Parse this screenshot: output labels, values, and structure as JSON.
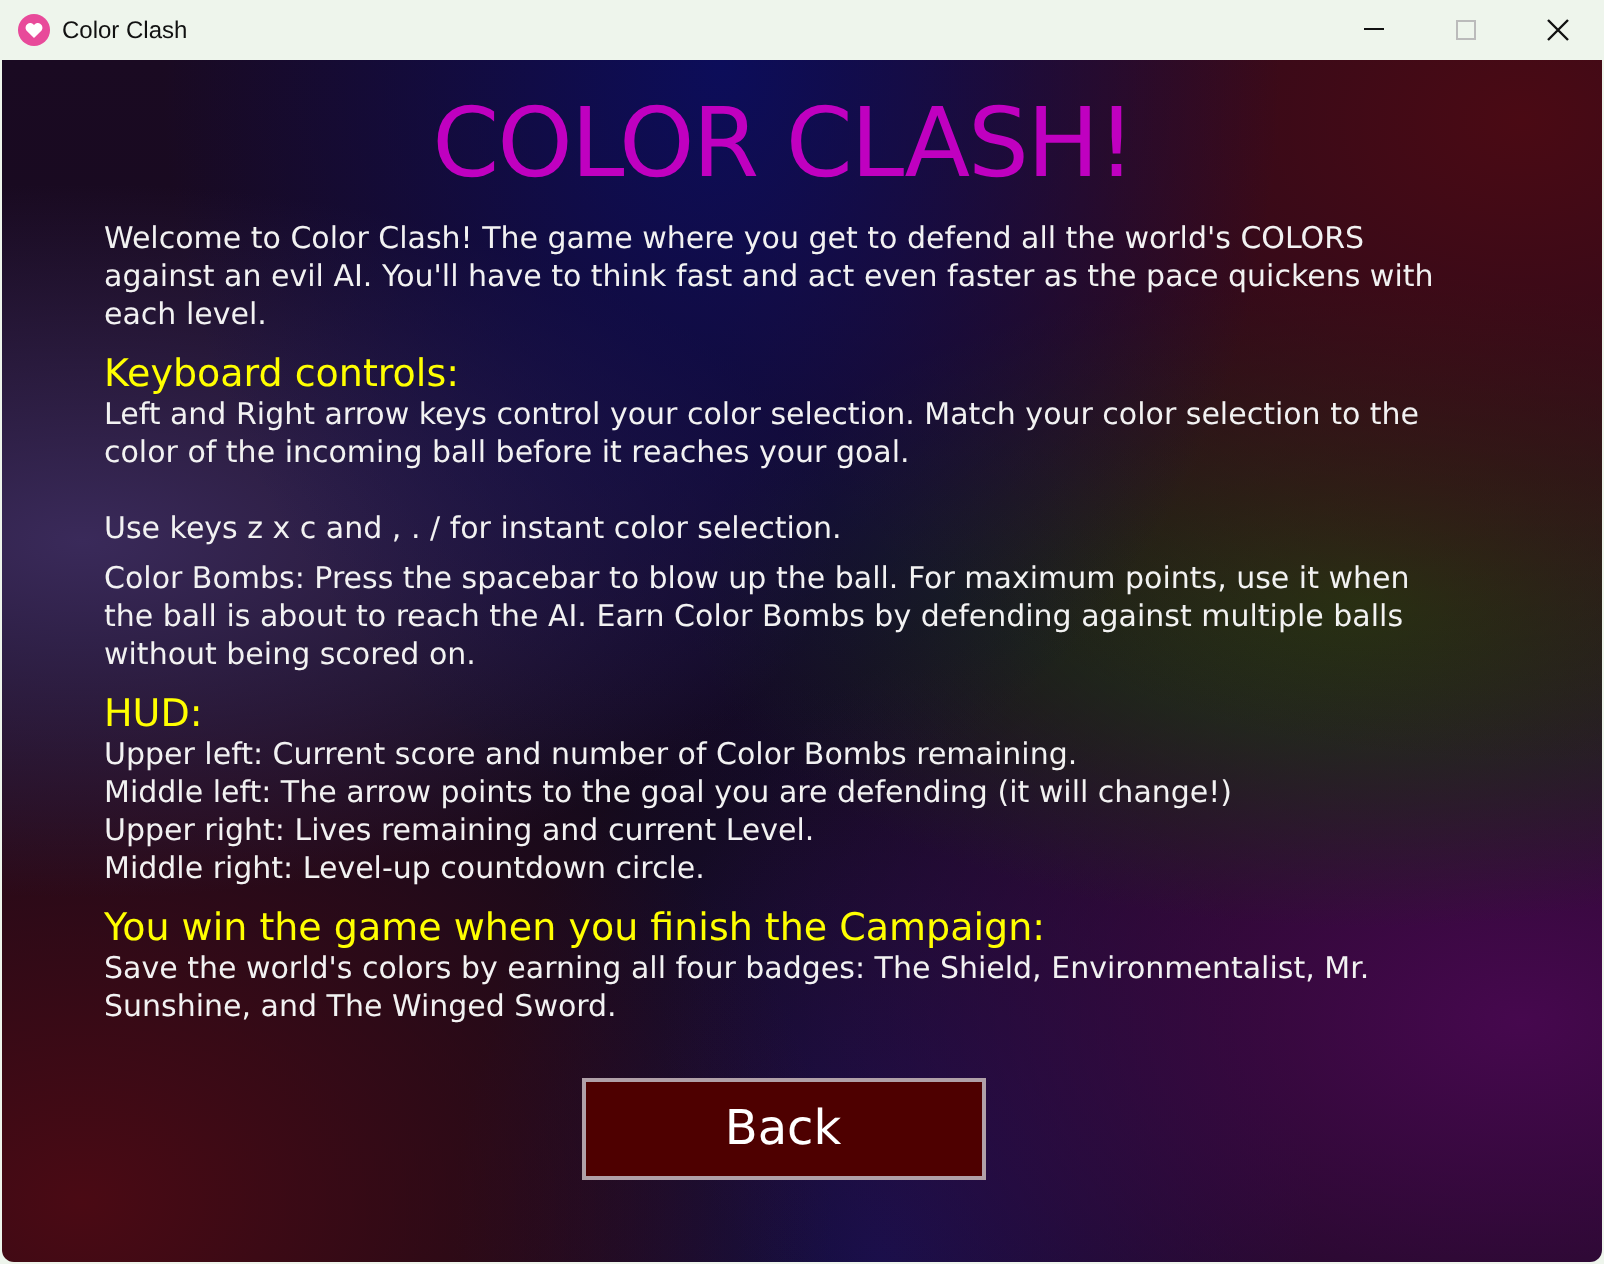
{
  "window": {
    "title": "Color Clash"
  },
  "heading": "COLOR CLASH!",
  "intro": "Welcome to Color Clash! The game where you get to defend all the world's COLORS against an evil AI. You'll have to think fast and act even faster as the pace quickens with each level.",
  "sections": [
    {
      "heading": "Keyboard controls:",
      "paragraphs": [
        {
          "kind": "paragraph",
          "text": "Left and Right arrow keys control your color selection. Match your color selection to the color of the incoming ball before it reaches your goal."
        },
        {
          "kind": "spaced",
          "text": "Use keys z x c and , . / for instant color selection."
        },
        {
          "kind": "paragraph",
          "text": "Color Bombs: Press the spacebar to blow up the ball. For maximum points, use it when the ball is about to reach the AI. Earn Color Bombs by defending against multiple balls without being scored on."
        }
      ]
    },
    {
      "heading": "HUD:",
      "paragraphs": [
        {
          "kind": "line",
          "text": "Upper left: Current score and number of Color Bombs remaining."
        },
        {
          "kind": "line",
          "text": "Middle left: The arrow points to the goal you are defending (it will change!)"
        },
        {
          "kind": "line",
          "text": "Upper right: Lives remaining and current Level."
        },
        {
          "kind": "line",
          "text": "Middle right: Level-up countdown circle."
        }
      ]
    },
    {
      "heading": "You win the game when you finish the Campaign:",
      "paragraphs": [
        {
          "kind": "paragraph",
          "text": "Save the world's colors by earning all four badges: The Shield, Environmentalist, Mr. Sunshine, and The Winged Sword."
        }
      ]
    }
  ],
  "back_button": "Back"
}
